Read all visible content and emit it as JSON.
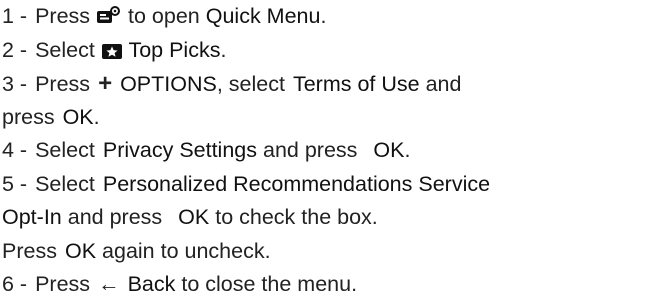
{
  "steps": [
    {
      "num": "1 -",
      "press": "Press",
      "icon": "quick-menu-icon",
      "to_open": "to open",
      "quick_menu": "Quick Menu",
      "end": "."
    },
    {
      "num": "2 -",
      "select": "Select",
      "icon": "top-picks-icon",
      "top_picks": "Top Picks",
      "end": "."
    },
    {
      "num": "3 -",
      "press": "Press",
      "plus": "+",
      "options": "OPTIONS",
      "select": ", select",
      "terms": "Terms of Use",
      "and": "and"
    },
    {
      "press": "press",
      "ok": "OK",
      "end": "."
    },
    {
      "num": "4 -",
      "select": "Select",
      "privacy": "Privacy Settings",
      "and_press": "and press",
      "ok": "OK",
      "end": "."
    },
    {
      "num": "5 -",
      "select": "Select",
      "personalized": "Personalized Recommendations Service"
    },
    {
      "optin": "Opt-In",
      "and_press": "and press",
      "ok": "OK",
      "check": "to check the box."
    },
    {
      "press": "Press",
      "ok": "OK",
      "again": "again to uncheck."
    },
    {
      "num": "6 -",
      "press": "Press",
      "arrow": "←",
      "back": "Back",
      "close": "to close the menu."
    }
  ]
}
